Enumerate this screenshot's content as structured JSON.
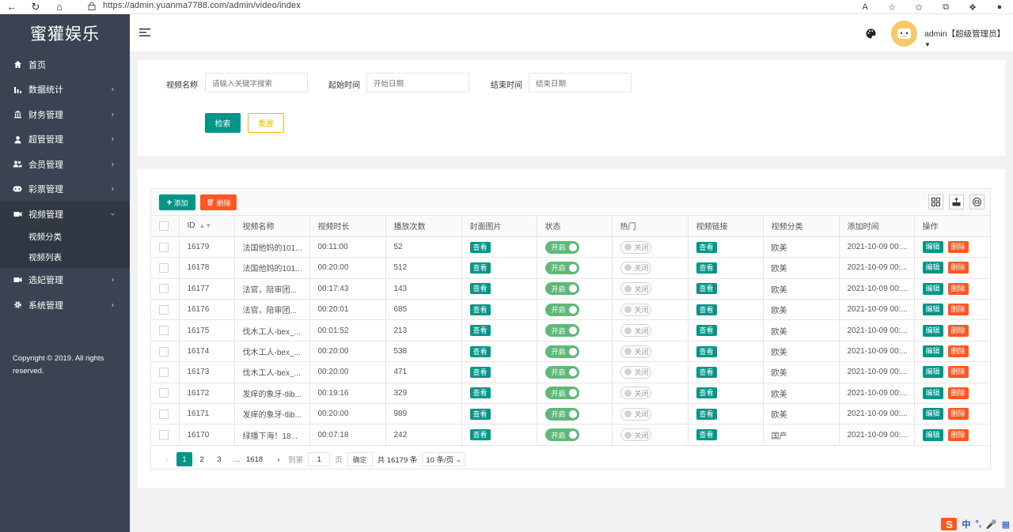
{
  "browser": {
    "url": "https://admin.yuanma7788.com/admin/video/index"
  },
  "sidebar": {
    "logo": "蜜獾娱乐",
    "items": [
      {
        "label": "首页",
        "icon": "home-icon"
      },
      {
        "label": "数据统计",
        "icon": "bar-chart-icon"
      },
      {
        "label": "财务管理",
        "icon": "bank-icon"
      },
      {
        "label": "超管管理",
        "icon": "user-icon"
      },
      {
        "label": "会员管理",
        "icon": "users-icon"
      },
      {
        "label": "彩票管理",
        "icon": "gamepad-icon"
      },
      {
        "label": "视频管理",
        "icon": "video-icon"
      },
      {
        "label": "选妃管理",
        "icon": "video-icon"
      },
      {
        "label": "系统管理",
        "icon": "gear-icon"
      }
    ],
    "video_sub": [
      "视频分类",
      "视频列表"
    ],
    "copyright": "Copyright © 2019. All rights reserved."
  },
  "header": {
    "user": "admin【超级管理员】"
  },
  "search": {
    "name_label": "视频名称",
    "name_placeholder": "请输入关键字搜索",
    "start_label": "起始时间",
    "start_placeholder": "开始日期",
    "end_label": "结束时间",
    "end_placeholder": "结束日期",
    "search_btn": "检索",
    "reset_btn": "重置"
  },
  "toolbar": {
    "add": "添加",
    "delete": "删除"
  },
  "table": {
    "headers": [
      "ID",
      "视频名称",
      "视频时长",
      "播放次数",
      "封面图片",
      "状态",
      "热门",
      "视频链接",
      "视频分类",
      "添加时间",
      "操作"
    ],
    "view_label": "查看",
    "on_label": "开启",
    "off_label": "关闭",
    "edit_label": "编辑",
    "del_label": "删除",
    "rows": [
      {
        "id": "16179",
        "name": "法国他妈的101...",
        "duration": "00:11:00",
        "plays": "52",
        "category": "欧美",
        "time": "2021-10-09 00:..."
      },
      {
        "id": "16178",
        "name": "法国他妈的101...",
        "duration": "00:20:00",
        "plays": "512",
        "category": "欧美",
        "time": "2021-10-09 00:..."
      },
      {
        "id": "16177",
        "name": "法官，陪审团...",
        "duration": "00:17:43",
        "plays": "143",
        "category": "欧美",
        "time": "2021-10-09 00:..."
      },
      {
        "id": "16176",
        "name": "法官，陪审团...",
        "duration": "00:20:01",
        "plays": "685",
        "category": "欧美",
        "time": "2021-10-09 00:..."
      },
      {
        "id": "16175",
        "name": "伐木工人-bex_...",
        "duration": "00:01:52",
        "plays": "213",
        "category": "欧美",
        "time": "2021-10-09 00:..."
      },
      {
        "id": "16174",
        "name": "伐木工人-bex_...",
        "duration": "00:20:00",
        "plays": "538",
        "category": "欧美",
        "time": "2021-10-09 00:..."
      },
      {
        "id": "16173",
        "name": "伐木工人-bex_...",
        "duration": "00:20:00",
        "plays": "471",
        "category": "欧美",
        "time": "2021-10-09 00:..."
      },
      {
        "id": "16172",
        "name": "发痒的象牙-tlib...",
        "duration": "00:19:16",
        "plays": "329",
        "category": "欧美",
        "time": "2021-10-09 00:..."
      },
      {
        "id": "16171",
        "name": "发痒的象牙-tlib...",
        "duration": "00:20:00",
        "plays": "989",
        "category": "欧美",
        "time": "2021-10-09 00:..."
      },
      {
        "id": "16170",
        "name": "绿播下海！18...",
        "duration": "00:07:18",
        "plays": "242",
        "category": "国产",
        "time": "2021-10-09 00:..."
      }
    ]
  },
  "pager": {
    "pages": [
      "1",
      "2",
      "3"
    ],
    "ellipsis": "…",
    "last": "1618",
    "goto_label": "到第",
    "goto_value": "1",
    "page_unit": "页",
    "confirm": "确定",
    "total": "共 16179 条",
    "per_page": "10 条/页"
  },
  "ime": {
    "logo": "S",
    "mode": "中"
  }
}
